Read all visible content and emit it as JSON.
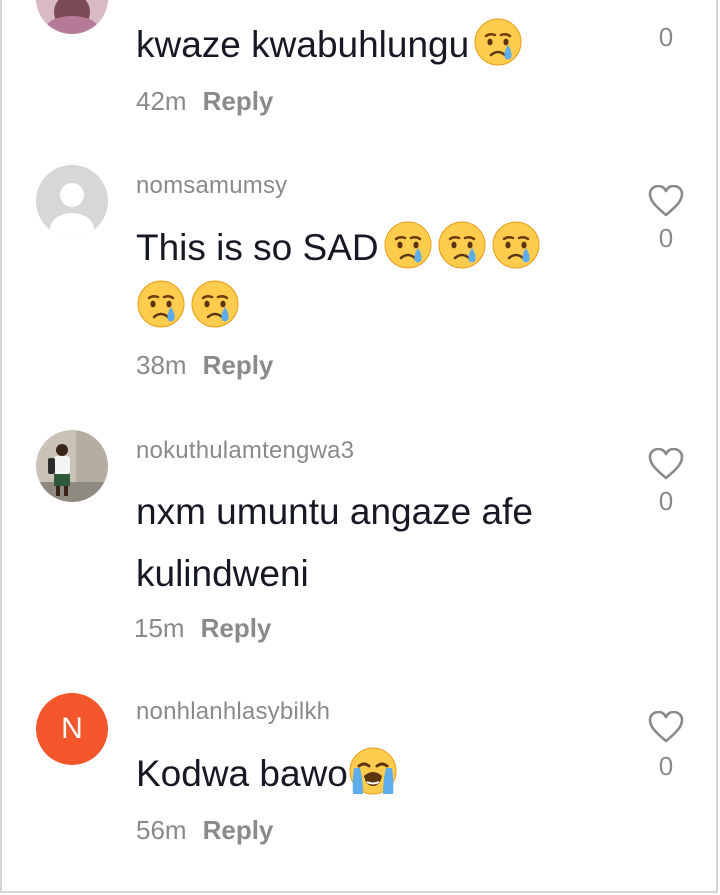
{
  "comments": [
    {
      "username": "",
      "text": "kwaze kwabuhlungu",
      "time": "42m",
      "reply": "Reply",
      "likes": "0",
      "emojis": [
        "crying-face"
      ]
    },
    {
      "username": "nomsamumsy",
      "text": "This is so SAD",
      "time": "38m",
      "reply": "Reply",
      "likes": "0",
      "emojis": [
        "crying-face",
        "crying-face",
        "crying-face",
        "crying-face",
        "crying-face"
      ]
    },
    {
      "username": "nokuthulamtengwa3",
      "text_line1": "nxm umuntu angaze afe",
      "text_line2": "kulindweni",
      "time": "15m",
      "reply": "Reply",
      "likes": "0"
    },
    {
      "username": "nonhlanhlasybilkh",
      "avatar_letter": "N",
      "text": "Kodwa bawo",
      "time": "56m",
      "reply": "Reply",
      "likes": "0",
      "emojis": [
        "loudly-crying-face"
      ]
    }
  ],
  "colors": {
    "text": "#161823",
    "secondary": "#8a8a8a",
    "avatar_n": "#f2562a",
    "avatar_default": "#d7d7d7"
  }
}
